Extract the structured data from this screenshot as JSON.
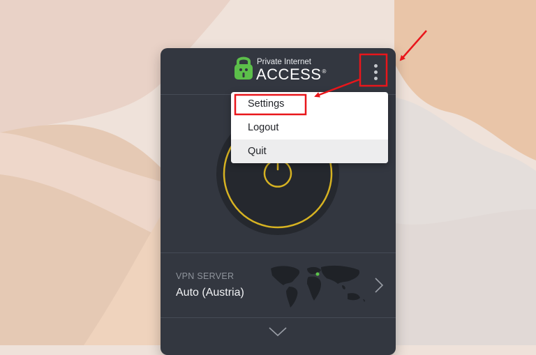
{
  "app": {
    "logo_line1": "Private Internet",
    "logo_line2": "ACCESS",
    "trademark": "®"
  },
  "menu": {
    "icon": "vertical-ellipsis-icon",
    "items": [
      {
        "label": "Settings",
        "highlighted_by_annotation": true
      },
      {
        "label": "Logout"
      },
      {
        "label": "Quit",
        "hovered": true
      }
    ]
  },
  "vpn_server": {
    "title": "VPN SERVER",
    "value": "Auto (Austria)"
  },
  "colors": {
    "window_bg": "#333740",
    "power_ring": "#d7b322",
    "annotation_red": "#e8161b",
    "map_dot": "#5cc24a",
    "logo_green": "#5cbf4a"
  },
  "icons": {
    "power": "power-icon",
    "map": "world-map-icon",
    "next": "chevron-right-icon",
    "expand": "chevron-down-icon"
  }
}
